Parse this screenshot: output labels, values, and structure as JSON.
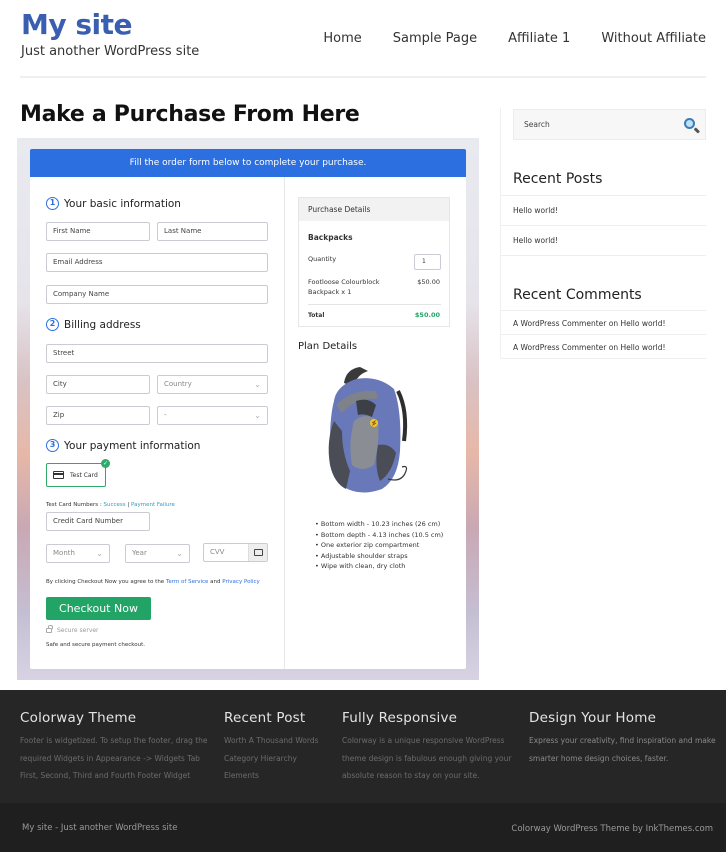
{
  "header": {
    "site_title": "My site",
    "tagline": "Just another WordPress site",
    "nav": [
      "Home",
      "Sample Page",
      "Affiliate 1",
      "Without Affiliate"
    ]
  },
  "page": {
    "title": "Make a Purchase From Here"
  },
  "checkout": {
    "banner": "Fill the order form below to complete your purchase.",
    "sections": {
      "basic": {
        "num": "1",
        "title": "Your basic information"
      },
      "billing": {
        "num": "2",
        "title": "Billing address"
      },
      "payment": {
        "num": "3",
        "title": "Your payment information"
      }
    },
    "fields": {
      "first_name": "First Name",
      "last_name": "Last Name",
      "email": "Email Address",
      "company": "Company Name",
      "street": "Street",
      "city": "City",
      "country": "Country",
      "zip": "Zip",
      "state": "-",
      "card_number": "Credit Card Number",
      "month": "Month",
      "year": "Year",
      "cvv": "CVV"
    },
    "payment_method": "Test Card",
    "test_numbers": {
      "label": "Test Card Numbers : ",
      "success": "Success",
      "separator": " | ",
      "failure": "Payment Failure"
    },
    "terms": {
      "prefix": "By clicking Checkout Now you agree to the ",
      "tos": "Term of Service",
      "and": " and ",
      "privacy": "Privacy Policy"
    },
    "checkout_button": "Checkout Now",
    "secure_server": "Secure server",
    "safe_text": "Safe and secure payment checkout.",
    "purchase_details": {
      "heading": "Purchase Details",
      "product_group": "Backpacks",
      "quantity_label": "Quantity",
      "quantity_value": "1",
      "item_name_line1": "Footloose Colourblock",
      "item_name_line2": "Backpack x 1",
      "item_price": "$50.00",
      "total_label": "Total",
      "total_value": "$50.00"
    },
    "plan_details": {
      "heading": "Plan Details",
      "features": [
        "Bottom width - 10.23 inches (26 cm)",
        "Bottom depth - 4.13 inches (10.5 cm)",
        "One exterior zip compartment",
        "Adjustable shoulder straps",
        "Wipe with clean, dry cloth"
      ]
    },
    "colors": {
      "banner": "#2b6fe0",
      "checkout_button": "#22a466",
      "total": "#22a466"
    }
  },
  "sidebar": {
    "search_placeholder": "Search",
    "recent_posts": {
      "title": "Recent Posts",
      "items": [
        "Hello world!",
        "Hello world!"
      ]
    },
    "recent_comments": {
      "title": "Recent Comments",
      "items": [
        "A WordPress Commenter on Hello world!",
        "A WordPress Commenter on Hello world!"
      ]
    }
  },
  "footer": {
    "columns": [
      {
        "title": "Colorway Theme",
        "lines": [
          "Footer is widgetized. To setup the footer, drag the",
          "required Widgets in Appearance -> Widgets Tab",
          "First, Second, Third and Fourth Footer Widget"
        ]
      },
      {
        "title": "Recent Post",
        "lines": [
          "Worth A Thousand Words",
          "Category Hierarchy",
          "Elements"
        ]
      },
      {
        "title": "Fully Responsive",
        "lines": [
          "Colorway is a unique responsive WordPress",
          "theme design is fabulous enough giving your",
          "absolute reason to stay on your site."
        ]
      },
      {
        "title": "Design Your Home",
        "lines": [
          "Express your creativity, find inspiration and make",
          "smarter home design choices, faster."
        ]
      }
    ],
    "bottom_left": "My site - Just another WordPress site",
    "bottom_right": "Colorway WordPress Theme by InkThemes.com"
  }
}
